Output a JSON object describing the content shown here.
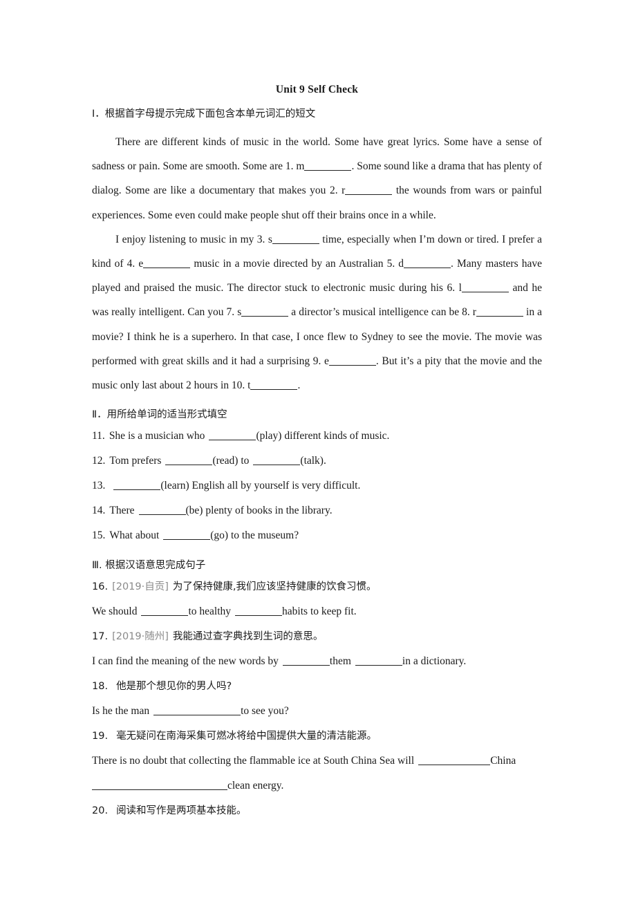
{
  "document": {
    "title": "Unit 9 Self Check"
  },
  "sections": {
    "one": {
      "heading": "Ⅰ．根据首字母提示完成下面包含本单元词汇的短文",
      "paragraph1": {
        "part1": "There are different kinds of music in the world. Some have great lyrics. Some have a sense of sadness or pain. Some are smooth. Some are 1. m",
        "part2": ". Some sound like a drama that has plenty of dialog. Some are like a documentary that makes you 2. r",
        "part3": " the wounds from wars or painful experiences. Some even could make people shut off their brains once in a while."
      },
      "paragraph2": {
        "part1": "I enjoy listening to music in my 3. s",
        "part2": " time, especially when I’m down or tired. I prefer a kind of 4. e",
        "part3": " music in a movie directed by an Australian 5. d",
        "part4": ". Many masters have played and praised the music. The director stuck to electronic music during his 6. l",
        "part5": " and he was really intelligent. Can you 7. s",
        "part6": " a director’s musical intelligence can be 8. r",
        "part7": " in a movie? I think he is a superhero. In that case, I once flew to Sydney to see the movie. The movie was performed with great skills and it had a surprising 9. e",
        "part8": ". But it’s a pity that the movie and the music only last about 2 hours in 10. t",
        "part9": "."
      }
    },
    "two": {
      "heading": "Ⅱ．用所给单词的适当形式填空",
      "items": [
        {
          "number": "11.",
          "before": "She is a musician who",
          "after": "(play) different kinds of music."
        },
        {
          "number": "12.",
          "before": "Tom prefers",
          "mid": "(read) to",
          "after": "(talk)."
        },
        {
          "number": "13.",
          "before": "",
          "after": "(learn) English all by yourself is very difficult."
        },
        {
          "number": "14.",
          "before": "There",
          "after": "(be) plenty of books in the library."
        },
        {
          "number": "15.",
          "before": "What about",
          "after": "(go) to the museum?"
        }
      ]
    },
    "three": {
      "heading": "Ⅲ. 根据汉语意思完成句子",
      "items": [
        {
          "number": "16.",
          "tag": "[2019·自贡]",
          "chinese": "为了保持健康,我们应该坚持健康的饮食习惯。",
          "answer_before": "We should",
          "answer_mid": "to healthy",
          "answer_after": "habits to keep fit."
        },
        {
          "number": "17.",
          "tag": "[2019·随州]",
          "chinese": "我能通过查字典找到生词的意思。",
          "answer_before": "I can find the meaning of the new words by",
          "answer_mid": "them",
          "answer_after": "in a dictionary."
        },
        {
          "number": "18.",
          "tag": "",
          "chinese": "他是那个想见你的男人吗?",
          "answer_before": "Is he the man",
          "answer_mid": "",
          "answer_after": "to see you?"
        },
        {
          "number": "19.",
          "tag": "",
          "chinese": "毫无疑问在南海采集可燃冰将给中国提供大量的清洁能源。",
          "answer_before": "There is no doubt that collecting the flammable ice at South China Sea will",
          "answer_mid": "China",
          "answer_after": "clean energy."
        },
        {
          "number": "20.",
          "tag": "",
          "chinese": "阅读和写作是两项基本技能。",
          "answer_before": "",
          "answer_mid": "",
          "answer_after": ""
        }
      ]
    }
  }
}
